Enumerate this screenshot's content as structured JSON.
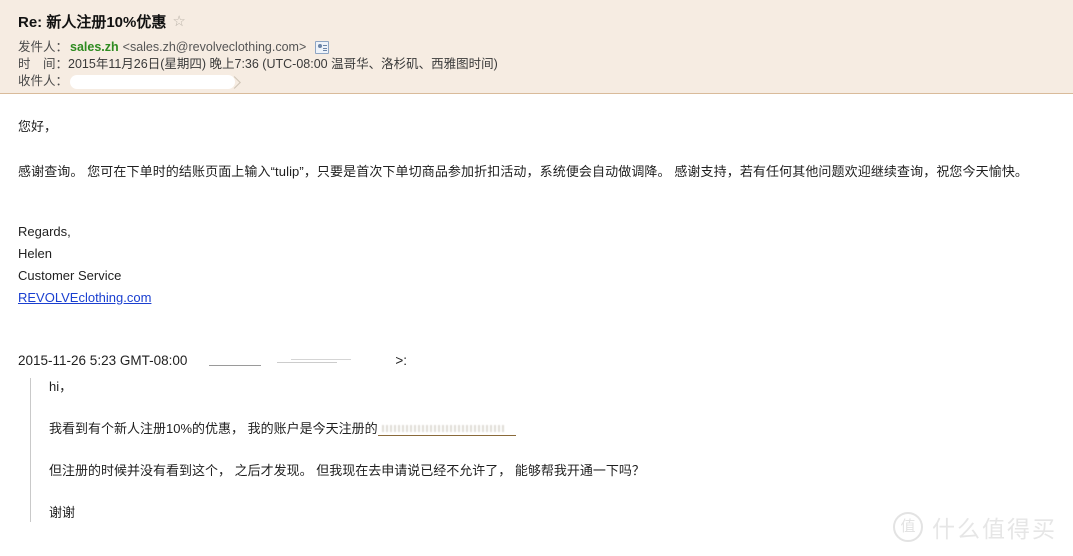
{
  "header": {
    "subject": "Re: 新人注册10%优惠",
    "star_icon": "star-outline-icon",
    "from_label": "发件人：",
    "from_name": "sales.zh",
    "from_address": "<sales.zh@revolveclothing.com>",
    "contact_card_icon": "contact-card-icon",
    "time_label": "时　间：",
    "time_value": "2015年11月26日(星期四) 晚上7:36 (UTC-08:00 温哥华、洛杉矶、西雅图时间)",
    "to_label": "收件人：",
    "to_value": "",
    "background_color": "#f6ece2",
    "border_color": "#d9bb9a",
    "sender_name_color": "#2e8b20"
  },
  "body": {
    "greeting": "您好，",
    "paragraph": "感谢查询。 您可在下单时的结账页面上输入“tulip”，只要是首次下单切商品参加折扣活动，系统便会自动做调降。 感谢支持，若有任何其他问题欢迎继续查询，祝您今天愉快。",
    "signature": [
      "Regards,",
      "Helen",
      "Customer Service"
    ],
    "signature_link": "REVOLVEclothing.com",
    "link_color": "#1a3fd0"
  },
  "quote": {
    "timestamp": "2015-11-26 5:23 GMT-08:00",
    "sender_redacted": "",
    "trailing": ">:",
    "lines": [
      "hi，",
      "我看到有个新人注册10%的优惠， 我的账户是今天注册的",
      "但注册的时候并没有看到这个， 之后才发现。 但我现在去申请说已经不允许了， 能够帮我开通一下吗？",
      "谢谢"
    ],
    "redacted_email_link": "",
    "bar_color": "#c9c9c9"
  },
  "watermark": {
    "badge": "值",
    "text": "什么值得买",
    "color": "#e6e6e6"
  }
}
